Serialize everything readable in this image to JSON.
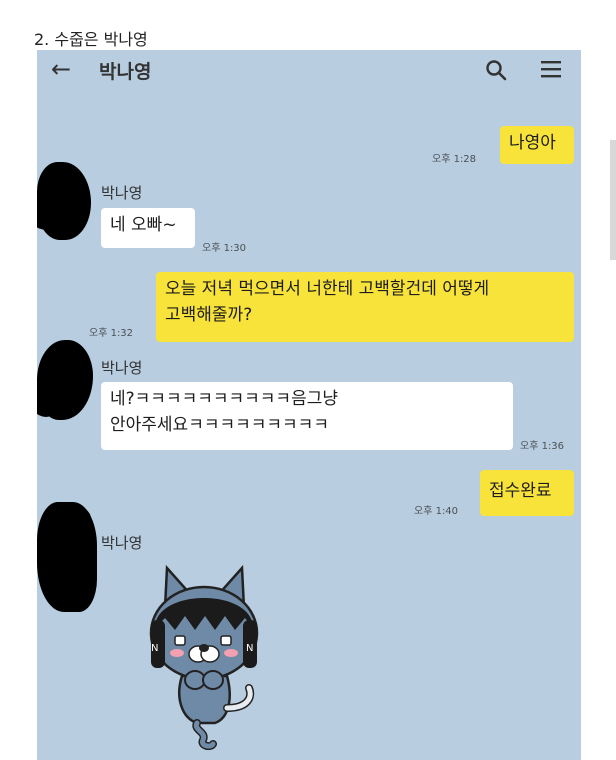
{
  "caption": "2. 수줍은 박나영",
  "header": {
    "title": "박나영",
    "back_icon": "arrow-left-icon",
    "search_icon": "search-icon",
    "menu_icon": "hamburger-menu-icon"
  },
  "messages": [
    {
      "from": "me",
      "text": "나영아",
      "time": "오후 1:28"
    },
    {
      "from": "other",
      "sender": "박나영",
      "text": "네 오빠~",
      "time": "오후 1:30"
    },
    {
      "from": "me",
      "text": "오늘 저녁 먹으면서 너한테 고백할건데 어떻게\n고백해줄까?",
      "time": "오후 1:32"
    },
    {
      "from": "other",
      "sender": "박나영",
      "text": "네?ㅋㅋㅋㅋㅋㅋㅋㅋㅋㅋ음그냥\n안아주세요ㅋㅋㅋㅋㅋㅋㅋㅋㅋ",
      "time": "오후 1:36"
    },
    {
      "from": "me",
      "text": "접수완료",
      "time": "오후 1:40"
    },
    {
      "from": "other",
      "sender": "박나영",
      "sticker": "shy-cat-sticker"
    }
  ],
  "colors": {
    "chat_background": "#b8cde0",
    "my_bubble": "#f8e33a",
    "other_bubble": "#ffffff"
  }
}
